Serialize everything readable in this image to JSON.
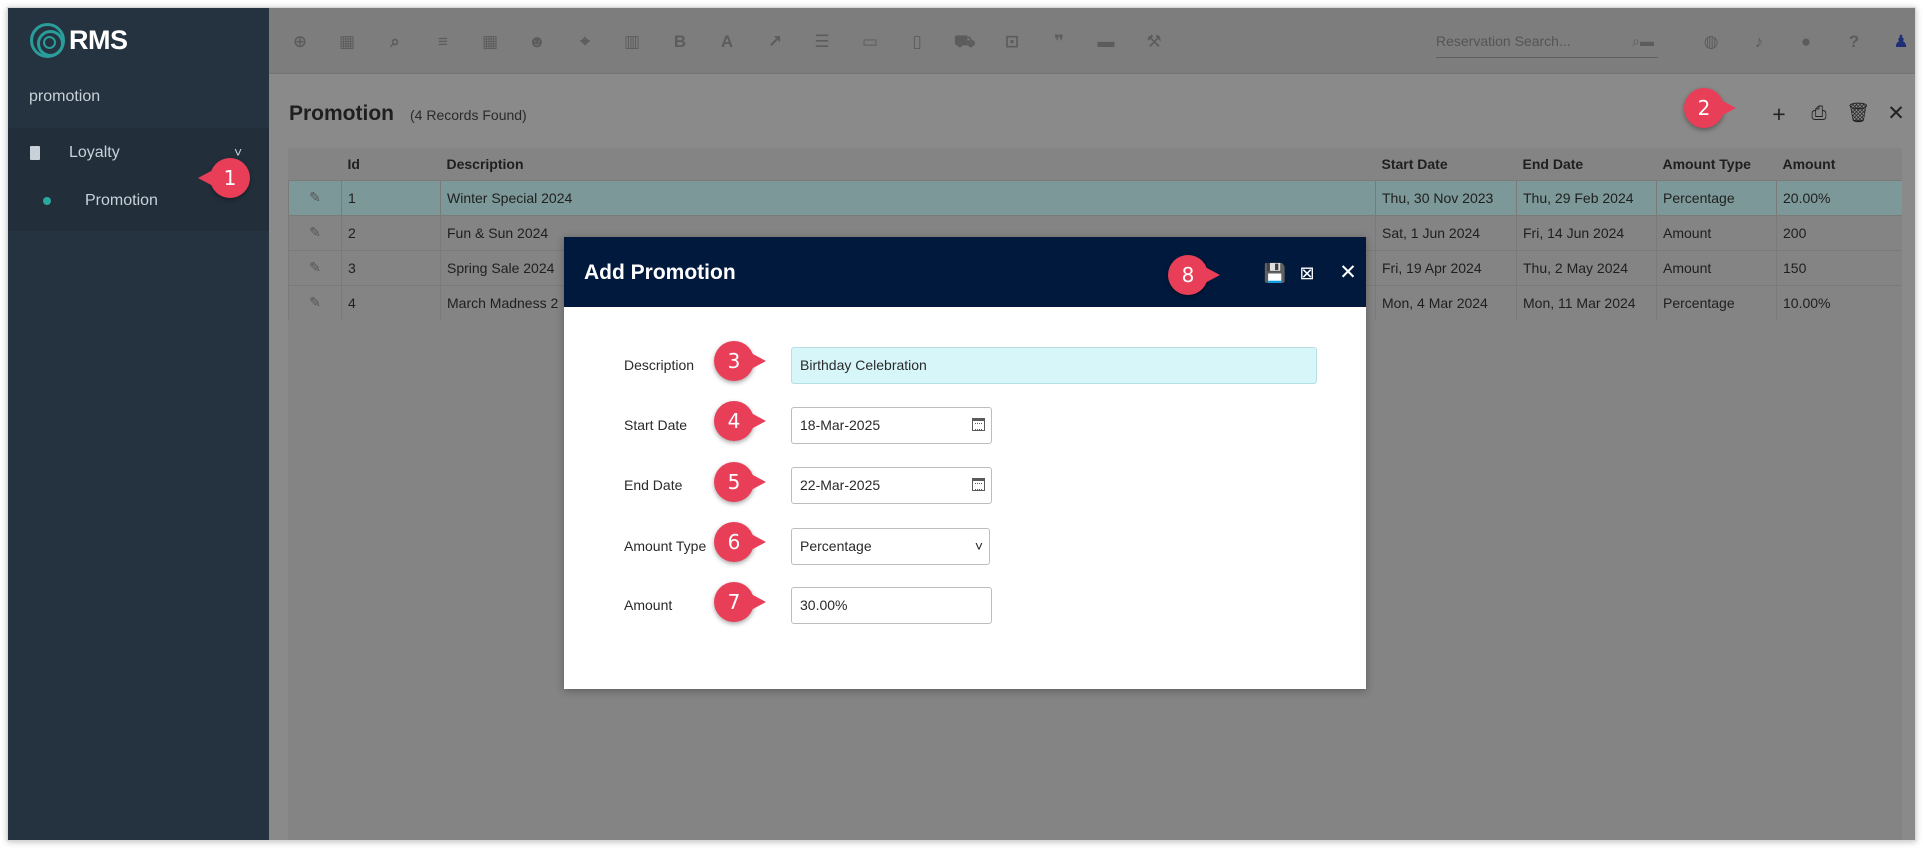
{
  "app": {
    "logo_text": "RMS"
  },
  "sidebar": {
    "search_text": "promotion",
    "items": [
      {
        "label": "Loyalty",
        "icon": "building-icon",
        "chevron": "˅"
      },
      {
        "label": "Promotion"
      }
    ]
  },
  "topbar": {
    "icons": [
      "plus-circle-icon",
      "calendar-icon",
      "search-icon",
      "sliders-icon",
      "grid-icon",
      "users-icon",
      "map-pin-icon",
      "map-icon",
      "bold-icon",
      "font-icon",
      "chart-line-icon",
      "checklist-icon",
      "id-card-icon",
      "document-icon",
      "cart-icon",
      "ticket-icon",
      "quote-icon",
      "bed-icon",
      "hammer-icon"
    ],
    "search_placeholder": "Reservation Search...",
    "right_icons": [
      "globe-icon",
      "bell-icon",
      "chat-icon",
      "help-icon",
      "user-icon"
    ]
  },
  "page": {
    "title": "Promotion",
    "records_found": "(4 Records Found)"
  },
  "table": {
    "columns": [
      "Id",
      "Description",
      "Start Date",
      "End Date",
      "Amount Type",
      "Amount"
    ],
    "rows": [
      {
        "id": "1",
        "description": "Winter Special 2024",
        "start": "Thu, 30 Nov 2023",
        "end": "Thu, 29 Feb 2024",
        "type": "Percentage",
        "amount": "20.00%"
      },
      {
        "id": "2",
        "description": "Fun & Sun 2024",
        "start": "Sat, 1 Jun 2024",
        "end": "Fri, 14 Jun 2024",
        "type": "Amount",
        "amount": "200"
      },
      {
        "id": "3",
        "description": "Spring Sale 2024",
        "start": "Fri, 19 Apr 2024",
        "end": "Thu, 2 May 2024",
        "type": "Amount",
        "amount": "150"
      },
      {
        "id": "4",
        "description": "March Madness 2",
        "start": "Mon, 4 Mar 2024",
        "end": "Mon, 11 Mar 2024",
        "type": "Percentage",
        "amount": "10.00%"
      }
    ]
  },
  "modal": {
    "title": "Add Promotion",
    "fields": {
      "description_label": "Description",
      "description_value": "Birthday Celebration",
      "start_label": "Start Date",
      "start_value": "18-Mar-2025",
      "end_label": "End Date",
      "end_value": "22-Mar-2025",
      "type_label": "Amount Type",
      "type_value": "Percentage",
      "amount_label": "Amount",
      "amount_value": "30.00%"
    }
  },
  "markers": [
    "1",
    "2",
    "3",
    "4",
    "5",
    "6",
    "7",
    "8"
  ],
  "colors": {
    "marker": "#e83e58",
    "modal_header": "#00193c",
    "sidebar": "#253340",
    "accent": "#2aa89e"
  }
}
